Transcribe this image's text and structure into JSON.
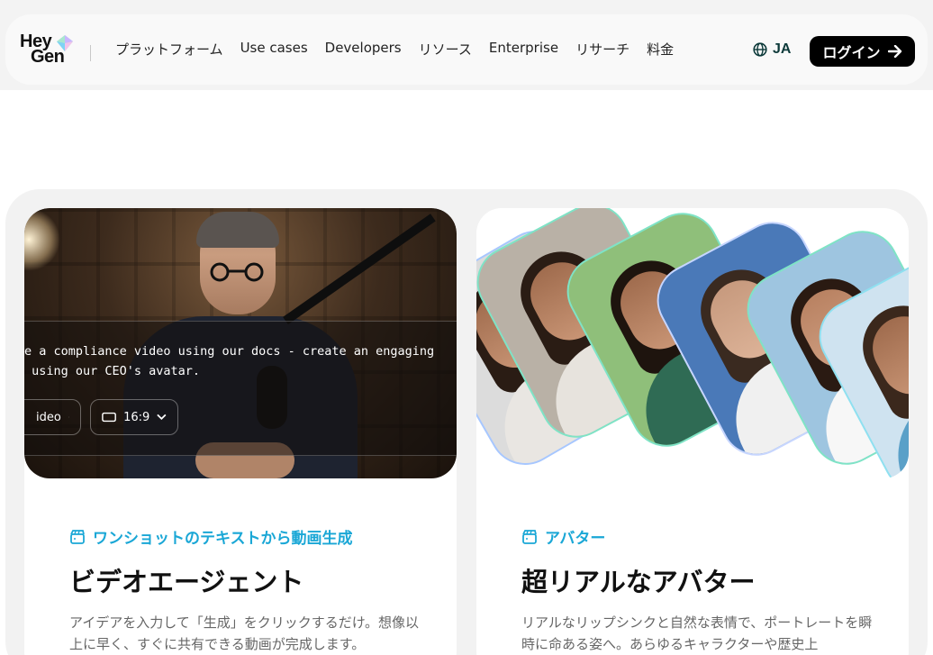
{
  "header": {
    "logo_line1": "Hey",
    "logo_line2": "Gen",
    "menu": [
      "プラットフォーム",
      "Use cases",
      "Developers",
      "リソース",
      "Enterprise",
      "リサーチ",
      "料金"
    ],
    "lang": "JA",
    "login": "ログイン"
  },
  "cards": [
    {
      "prompt_line1": "e a compliance video using our docs - create an engaging",
      "prompt_line2": " using our CEO's avatar.",
      "chip_type": "ideo",
      "chip_ratio": "16:9",
      "category": "ワンショットのテキストから動画生成",
      "title": "ビデオエージェント",
      "description": "アイデアを入力して「生成」をクリックするだけ。想像以上に早く、すぐに共有できる動画が完成します。"
    },
    {
      "category": "アバター",
      "title": "超リアルなアバター",
      "description": "リアルなリップシンクと自然な表情で、ポートレートを瞬時に命ある姿へ。あらゆるキャラクターや歴史上"
    }
  ],
  "colors": {
    "accent": "#1aa7d6",
    "login_bg": "#000000",
    "lang": "#0d3a3a"
  }
}
